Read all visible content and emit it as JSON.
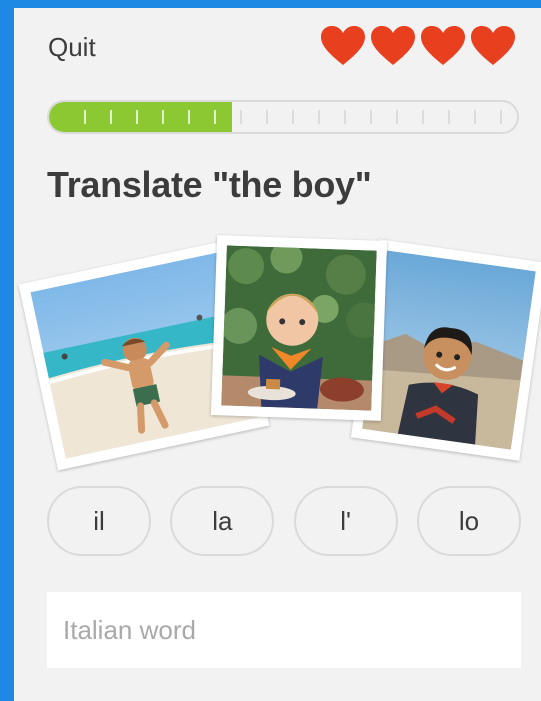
{
  "header": {
    "quit_label": "Quit",
    "hearts_count": 4,
    "heart_color": "#e8401f"
  },
  "progress": {
    "fraction": 0.39,
    "segments": 18,
    "fill_color": "#8bc832"
  },
  "prompt": {
    "text": "Translate \"the boy\""
  },
  "images": [
    {
      "subject": "boy running on beach"
    },
    {
      "subject": "toddler with orange bib at table"
    },
    {
      "subject": "smiling boy outdoors"
    }
  ],
  "choices": [
    {
      "label": "il"
    },
    {
      "label": "la"
    },
    {
      "label": "l'"
    },
    {
      "label": "lo"
    }
  ],
  "answer": {
    "placeholder": "Italian word",
    "value": ""
  },
  "colors": {
    "accent_blue": "#1e88e5",
    "text": "#3c3c3c",
    "border": "#dadada"
  }
}
